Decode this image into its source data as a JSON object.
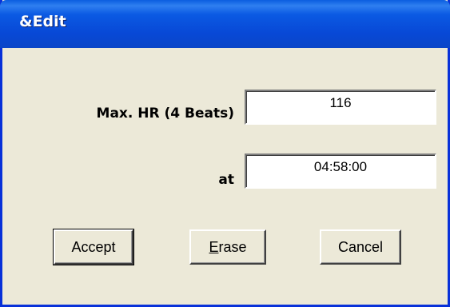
{
  "window": {
    "title": "&Edit"
  },
  "fields": {
    "max_hr": {
      "label": "Max. HR (4 Beats)",
      "value": "116"
    },
    "at": {
      "label": "at",
      "value": "04:58:00"
    }
  },
  "buttons": {
    "accept": {
      "label": "Accept"
    },
    "erase": {
      "mnemonic": "E",
      "rest": "rase"
    },
    "cancel": {
      "label": "Cancel"
    }
  },
  "colors": {
    "titlebar": "#0848d6",
    "dialog_bg": "#ece9d8",
    "frame": "#0831d9"
  }
}
